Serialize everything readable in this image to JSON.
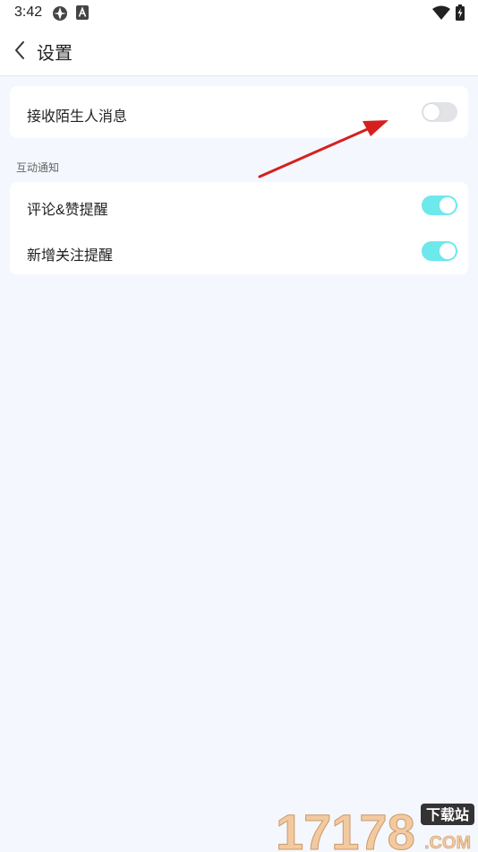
{
  "status_bar": {
    "time": "3:42",
    "icons": [
      "app-notification-icon",
      "a-notification-icon",
      "wifi-icon",
      "battery-charging-icon"
    ]
  },
  "header": {
    "back_icon": "chevron-left-icon",
    "title": "设置"
  },
  "stranger_card": {
    "items": [
      {
        "label": "接收陌生人消息",
        "enabled": false
      }
    ]
  },
  "interaction_section": {
    "title": "互动通知",
    "items": [
      {
        "label": "评论&赞提醒",
        "enabled": true
      },
      {
        "label": "新增关注提醒",
        "enabled": true
      }
    ]
  },
  "annotation": {
    "type": "arrow",
    "color": "#d61f1f"
  },
  "watermark": {
    "main": "17178",
    "badge": "下载站",
    "suffix": ".COM"
  },
  "colors": {
    "page_background": "#f4f7fe",
    "card_background": "#ffffff",
    "toggle_on": "#6de8eb",
    "toggle_off": "#e2e3e6"
  }
}
